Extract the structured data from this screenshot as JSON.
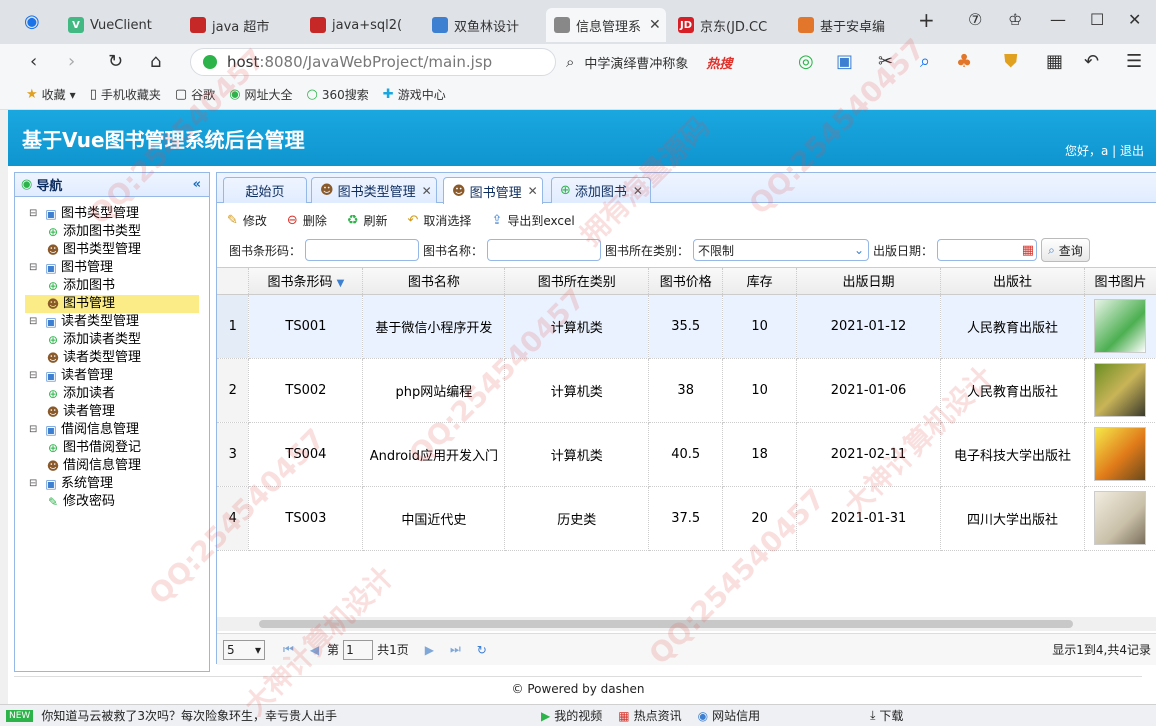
{
  "browser": {
    "tabs": [
      {
        "label": "VueClient"
      },
      {
        "label": "java 超市"
      },
      {
        "label": "java+sql2("
      },
      {
        "label": "双鱼林设计"
      },
      {
        "label": "信息管理系"
      },
      {
        "label": "京东(JD.CC"
      },
      {
        "label": "基于安卓编"
      }
    ],
    "url_host": "host",
    "url_path": ":8080/JavaWebProject/main.jsp",
    "search_text": "中学演绎曹冲称象",
    "search_hot": "热搜",
    "bookmarks": [
      "收藏",
      "手机收藏夹",
      "谷歌",
      "网址大全",
      "360搜索",
      "游戏中心"
    ]
  },
  "app": {
    "title": "基于Vue图书管理系统后台管理",
    "greeting": "您好，a",
    "logout": "退出"
  },
  "nav": {
    "title": "导航",
    "tree": [
      {
        "label": "图书类型管理",
        "level": 0
      },
      {
        "label": "添加图书类型",
        "level": 1
      },
      {
        "label": "图书类型管理",
        "level": 1
      },
      {
        "label": "图书管理",
        "level": 0
      },
      {
        "label": "添加图书",
        "level": 1
      },
      {
        "label": "图书管理",
        "level": 1
      },
      {
        "label": "读者类型管理",
        "level": 0
      },
      {
        "label": "添加读者类型",
        "level": 1
      },
      {
        "label": "读者类型管理",
        "level": 1
      },
      {
        "label": "读者管理",
        "level": 0
      },
      {
        "label": "添加读者",
        "level": 1
      },
      {
        "label": "读者管理",
        "level": 1
      },
      {
        "label": "借阅信息管理",
        "level": 0
      },
      {
        "label": "图书借阅登记",
        "level": 1
      },
      {
        "label": "借阅信息管理",
        "level": 1
      },
      {
        "label": "系统管理",
        "level": 0
      },
      {
        "label": "修改密码",
        "level": 1
      }
    ]
  },
  "tabs": [
    "起始页",
    "图书类型管理",
    "图书管理",
    "添加图书"
  ],
  "toolbar": {
    "edit": "修改",
    "delete": "删除",
    "refresh": "刷新",
    "unselect": "取消选择",
    "export": "导出到excel"
  },
  "filters": {
    "barcode_label": "图书条形码：",
    "name_label": "图书名称：",
    "type_label": "图书所在类别：",
    "type_value": "不限制",
    "date_label": "出版日期：",
    "query": "查询"
  },
  "grid": {
    "columns": [
      "图书条形码",
      "图书名称",
      "图书所在类别",
      "图书价格",
      "库存",
      "出版日期",
      "出版社",
      "图书图片"
    ],
    "rows": [
      {
        "n": "1",
        "barcode": "TS001",
        "name": "基于微信小程序开发",
        "type": "计算机类",
        "price": "35.5",
        "stock": "10",
        "date": "2021-01-12",
        "press": "人民教育出版社"
      },
      {
        "n": "2",
        "barcode": "TS002",
        "name": "php网站编程",
        "type": "计算机类",
        "price": "38",
        "stock": "10",
        "date": "2021-01-06",
        "press": "人民教育出版社"
      },
      {
        "n": "3",
        "barcode": "TS004",
        "name": "Android应用开发入门",
        "type": "计算机类",
        "price": "40.5",
        "stock": "18",
        "date": "2021-02-11",
        "press": "电子科技大学出版社"
      },
      {
        "n": "4",
        "barcode": "TS003",
        "name": "中国近代史",
        "type": "历史类",
        "price": "37.5",
        "stock": "20",
        "date": "2021-01-31",
        "press": "四川大学出版社"
      }
    ]
  },
  "pager": {
    "page_size": "5",
    "page_prefix": "第",
    "page_value": "1",
    "page_total": "共1页",
    "info": "显示1到4,共4记录"
  },
  "footer": "© Powered by dashen",
  "statusbar": {
    "badge": "NEW",
    "news": "你知道马云被救了3次吗？每次险象环生，幸亏贵人出手",
    "items": [
      "我的视频",
      "热点资讯",
      "网站信用",
      "下载"
    ]
  },
  "watermarks": [
    "QQ:254540457",
    "拥有海量源码",
    "大神计算机设计"
  ],
  "colors": {
    "header": "#1aa7e0",
    "border": "#95b8e7",
    "selected": "#fbec88"
  }
}
